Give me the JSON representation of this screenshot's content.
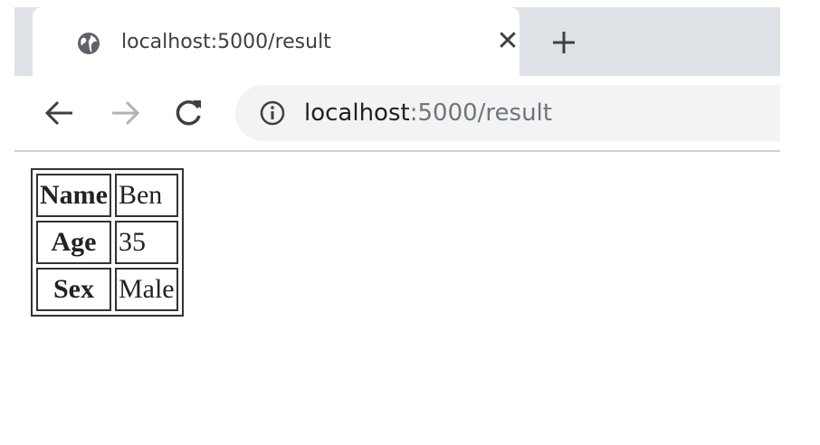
{
  "tab": {
    "title": "localhost:5000/result",
    "favicon": "globe-icon",
    "close_glyph": "✕"
  },
  "new_tab": {
    "icon": "plus-icon"
  },
  "toolbar": {
    "back_icon": "arrow-left-icon",
    "forward_icon": "arrow-right-icon",
    "reload_icon": "reload-icon",
    "site_info_icon": "info-icon"
  },
  "address_bar": {
    "host": "localhost",
    "path": ":5000/result"
  },
  "result_table": {
    "rows": [
      {
        "label": "Name",
        "value": "Ben"
      },
      {
        "label": "Age",
        "value": "35"
      },
      {
        "label": "Sex",
        "value": "Male"
      }
    ]
  },
  "colors": {
    "tabstrip": "#dee1e6",
    "omnibox": "#f1f3f4",
    "text": "#3c4043",
    "url_path": "#70757a"
  }
}
